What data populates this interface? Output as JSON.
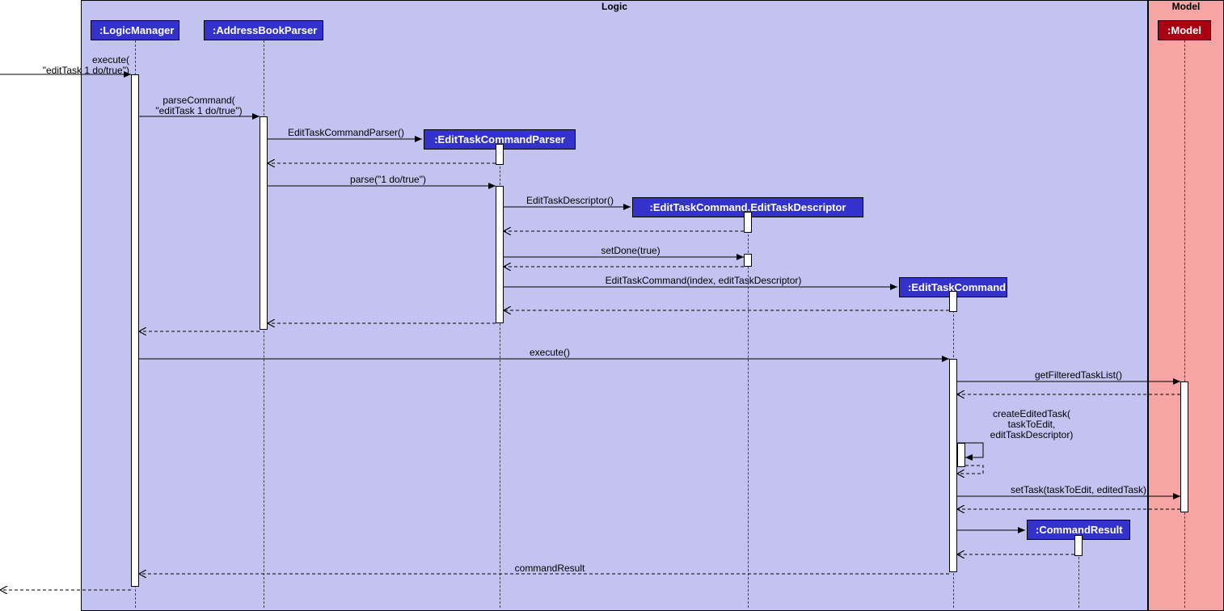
{
  "frames": {
    "logic": {
      "title": "Logic"
    },
    "model": {
      "title": "Model"
    }
  },
  "participants": {
    "logicManager": ":LogicManager",
    "addressBookParser": ":AddressBookParser",
    "editTaskCommandParser": ":EditTaskCommandParser",
    "editTaskDescriptor": ":EditTaskCommand.EditTaskDescriptor",
    "editTaskCommand": ":EditTaskCommand",
    "commandResult": ":CommandResult",
    "model": ":Model"
  },
  "messages": {
    "execute_in": "execute(\n\"editTask 1 do/true\")",
    "parseCommand": "parseCommand(\n\"editTask 1 do/true\")",
    "editTaskCommandParser_ctor": "EditTaskCommandParser()",
    "parse": "parse(\"1 do/true\")",
    "editTaskDescriptor_ctor": "EditTaskDescriptor()",
    "setDone": "setDone(true)",
    "editTaskCommand_ctor": "EditTaskCommand(index, editTaskDescriptor)",
    "execute": "execute()",
    "getFilteredTaskList": "getFilteredTaskList()",
    "createEditedTask": "createEditedTask(\ntaskToEdit,\neditTaskDescriptor)",
    "setTask": "setTask(taskToEdit, editedTask)",
    "commandResult": "commandResult"
  }
}
